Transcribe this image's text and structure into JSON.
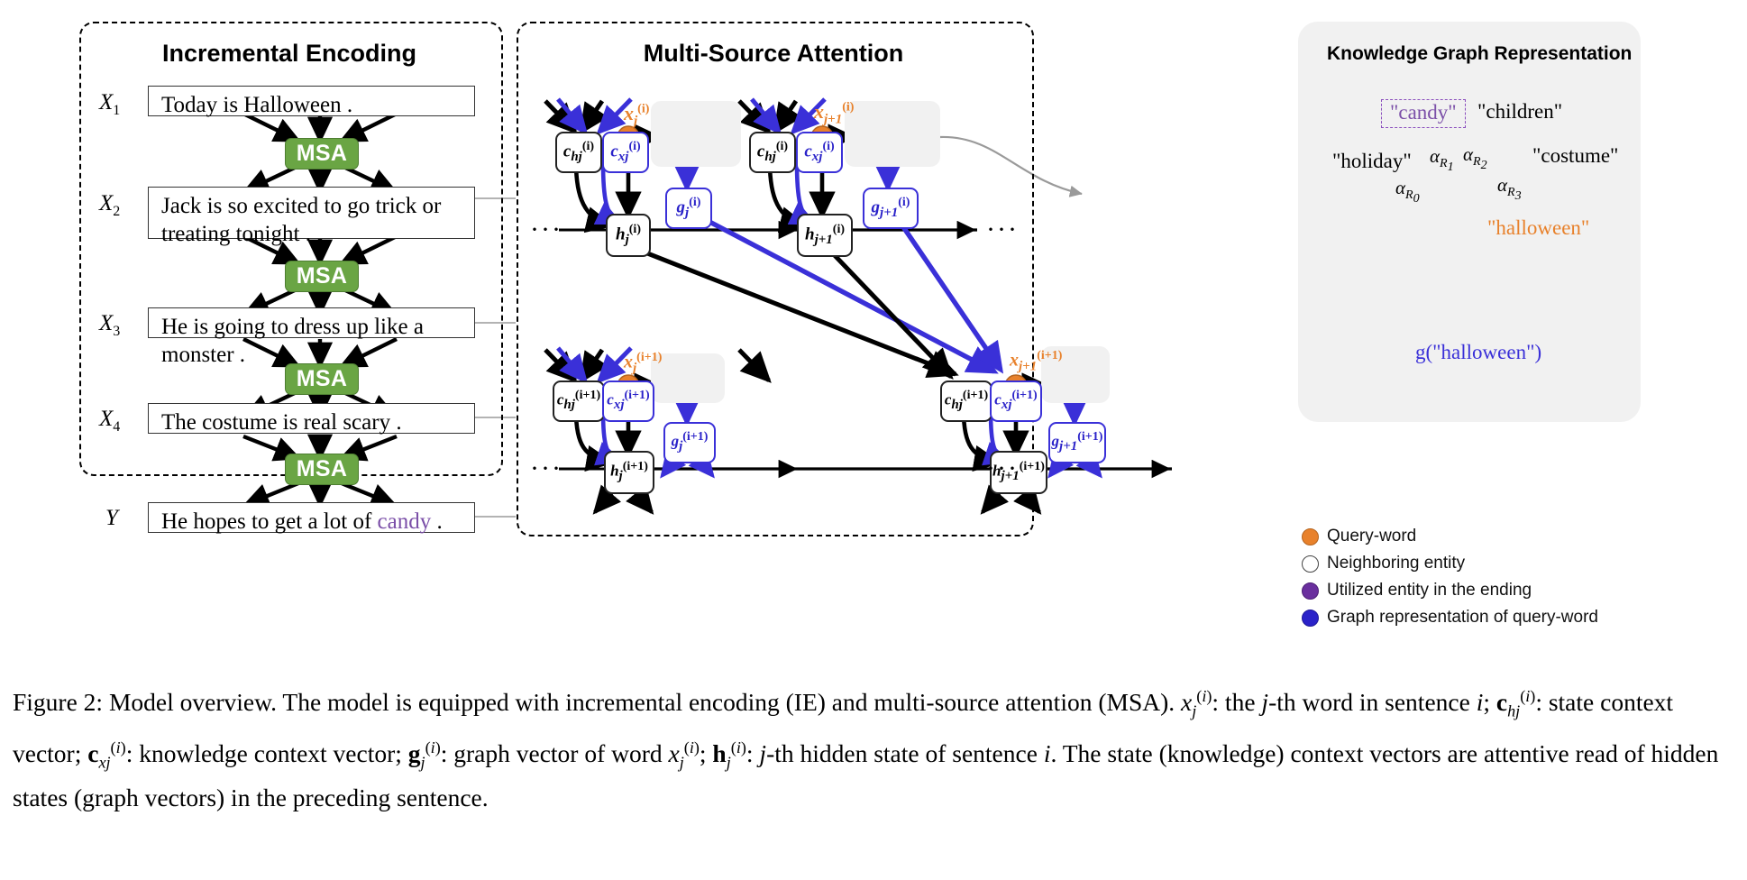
{
  "figure": {
    "caption_prefix": "Figure 2: Model overview.",
    "caption_full": "Figure 2: Model overview. The model is equipped with incremental encoding (IE) and multi-source attention (MSA). x(i)j: the j-th word in sentence i; c(i)hj: state context vector; c(i)xj: knowledge context vector; g(i)j: graph vector of word x(i)j; h(i)j: j-th hidden state of sentence i. The state (knowledge) context vectors are attentive read of hidden states (graph vectors) in the preceding sentence."
  },
  "panels": {
    "incremental_encoding": {
      "title": "Incremental Encoding",
      "sentences": [
        {
          "label": "X",
          "sub": "1",
          "text": "Today is Halloween ."
        },
        {
          "label": "X",
          "sub": "2",
          "text": "Jack is so excited to go trick or treating tonight ."
        },
        {
          "label": "X",
          "sub": "3",
          "text": "He is going to dress up like a monster ."
        },
        {
          "label": "X",
          "sub": "4",
          "text": "The costume is real scary ."
        },
        {
          "label": "Y",
          "sub": "",
          "text_before": "He hopes to get a lot of ",
          "highlight": "candy",
          "text_after": " ."
        }
      ],
      "msa_label": "MSA",
      "msa_count": 4
    },
    "multi_source_attention": {
      "title": "Multi-Source Attention",
      "ellipsis": "···",
      "cells": [
        {
          "id": "top-j",
          "c_h": {
            "base": "c",
            "sub": "hj",
            "sup": "(i)"
          },
          "c_x": {
            "base": "c",
            "sub": "xj",
            "sup": "(i)"
          },
          "x": {
            "base": "x",
            "sub": "j",
            "sup": "(i)"
          },
          "g": {
            "base": "g",
            "sub": "j",
            "sup": "(i)"
          },
          "h": {
            "base": "h",
            "sub": "j",
            "sup": "(i)"
          },
          "graph_kind": "two-neighbors"
        },
        {
          "id": "top-j1",
          "c_h": {
            "base": "c",
            "sub": "hj",
            "sup": "(i)"
          },
          "c_x": {
            "base": "c",
            "sub": "xj",
            "sup": "(i)"
          },
          "x": {
            "base": "x",
            "sub": "j+1",
            "sup": "(i)"
          },
          "g": {
            "base": "g",
            "sub": "j+1",
            "sup": "(i)"
          },
          "h": {
            "base": "h",
            "sub": "j+1",
            "sup": "(i)"
          },
          "graph_kind": "four-neighbors-with-utilized"
        },
        {
          "id": "bot-j",
          "c_h": {
            "base": "c",
            "sub": "hj",
            "sup": "(i+1)"
          },
          "c_x": {
            "base": "c",
            "sub": "xj",
            "sup": "(i+1)"
          },
          "x": {
            "base": "x",
            "sub": "j",
            "sup": "(i+1)"
          },
          "g": {
            "base": "g",
            "sub": "j",
            "sup": "(i+1)"
          },
          "h": {
            "base": "h",
            "sub": "j",
            "sup": "(i+1)"
          },
          "graph_kind": "single-query"
        },
        {
          "id": "bot-j1",
          "c_h": {
            "base": "c",
            "sub": "hj",
            "sup": "(i+1)"
          },
          "c_x": {
            "base": "c",
            "sub": "xj",
            "sup": "(i+1)"
          },
          "x": {
            "base": "x",
            "sub": "j+1",
            "sup": "(i+1)"
          },
          "g": {
            "base": "g",
            "sub": "j+1",
            "sup": "(i+1)"
          },
          "h": {
            "base": "h",
            "sub": "j+1",
            "sup": "(i+1)"
          },
          "graph_kind": "one-neighbor"
        }
      ]
    },
    "knowledge_graph": {
      "title": "Knowledge Graph Representation",
      "center_entity": "\"halloween\"",
      "graph_vector_label": "g(\"halloween\")",
      "entities": [
        {
          "name": "\"candy\"",
          "kind": "utilized",
          "boxed": true
        },
        {
          "name": "\"children\"",
          "kind": "neighbor",
          "boxed": false
        },
        {
          "name": "\"costume\"",
          "kind": "neighbor",
          "boxed": false
        },
        {
          "name": "\"holiday\"",
          "kind": "neighbor",
          "boxed": false
        }
      ],
      "edge_labels": [
        {
          "text": "α",
          "sub": "R₀"
        },
        {
          "text": "α",
          "sub": "R₁"
        },
        {
          "text": "α",
          "sub": "R₂"
        },
        {
          "text": "α",
          "sub": "R₃"
        }
      ]
    },
    "legend": {
      "items": [
        {
          "label": "Query-word",
          "color": "#e8812b",
          "border": "#b4641f"
        },
        {
          "label": "Neighboring entity",
          "color": "#ffffff",
          "border": "#444444"
        },
        {
          "label": "Utilized entity in the ending",
          "color": "#6a2f9e",
          "border": "#4c1f75"
        },
        {
          "label": "Graph representation of query-word",
          "color": "#2a22c9",
          "border": "#1d1899"
        }
      ]
    }
  },
  "colors": {
    "msa_green": "#6aa544",
    "query_orange": "#e8812b",
    "knowledge_blue": "#3a30d8",
    "utilized_purple": "#6a2f9e",
    "candy_purple": "#7b4fa8",
    "panel_gray": "#f1f1f1"
  }
}
